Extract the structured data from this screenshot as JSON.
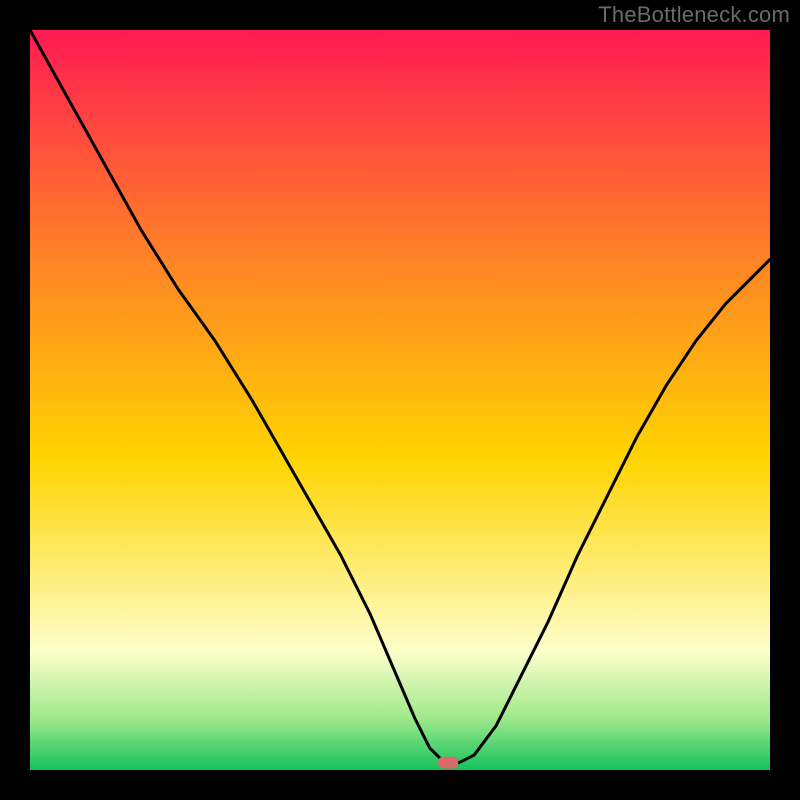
{
  "watermark": "TheBottleneck.com",
  "colors": {
    "background": "#000000",
    "watermark_text": "#6a6a6a",
    "curve": "#000000",
    "marker_fill": "#d86a6a",
    "gradient_top": "#ff1a52",
    "gradient_upper_mid": "#ff7a2a",
    "gradient_mid": "#ffd400",
    "gradient_lower_band": "#fdfecb",
    "gradient_thin_band": "#9fe98a",
    "gradient_bottom": "#13c25d"
  },
  "chart_data": {
    "type": "line",
    "title": "",
    "xlabel": "",
    "ylabel": "",
    "xlim": [
      0,
      100
    ],
    "ylim": [
      0,
      100
    ],
    "legend": false,
    "grid": false,
    "series": [
      {
        "name": "bottleneck-curve",
        "x": [
          0,
          5,
          10,
          15,
          20,
          25,
          30,
          34,
          38,
          42,
          46,
          49,
          52,
          54,
          56,
          58,
          60,
          63,
          66,
          70,
          74,
          78,
          82,
          86,
          90,
          94,
          98,
          100
        ],
        "y": [
          100,
          91,
          82,
          73,
          65,
          58,
          50,
          43,
          36,
          29,
          21,
          14,
          7,
          3,
          1,
          1,
          2,
          6,
          12,
          20,
          29,
          37,
          45,
          52,
          58,
          63,
          67,
          69
        ]
      }
    ],
    "marker": {
      "x": 56.5,
      "y": 1,
      "shape": "rounded-rect",
      "color": "#d86a6a"
    }
  }
}
